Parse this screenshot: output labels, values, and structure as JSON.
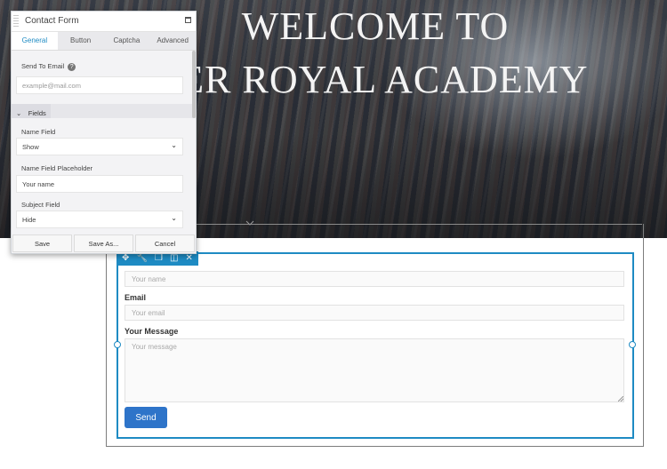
{
  "hero": {
    "line1": "WELCOME TO",
    "line2": "AVER ROYAL ACADEMY"
  },
  "contact_form": {
    "toolbar_icons": [
      "move-icon",
      "wrench-icon",
      "copy-icon",
      "columns-icon",
      "close-icon"
    ],
    "name_placeholder": "Your name",
    "email_label": "Email",
    "email_placeholder": "Your email",
    "message_label": "Your Message",
    "message_placeholder": "Your message",
    "send_label": "Send"
  },
  "panel": {
    "grip_text": "MOVE",
    "title": "Contact Form",
    "tabs": [
      {
        "label": "General",
        "active": true
      },
      {
        "label": "Button",
        "active": false
      },
      {
        "label": "Captcha",
        "active": false
      },
      {
        "label": "Advanced",
        "active": false
      }
    ],
    "send_to_email_label": "Send To Email",
    "help_icon": "?",
    "send_to_email_placeholder": "example@mail.com",
    "section_label": "Fields",
    "name_field_label": "Name Field",
    "name_field_value": "Show",
    "name_placeholder_label": "Name Field Placeholder",
    "name_placeholder_value": "Your name",
    "subject_field_label": "Subject Field",
    "subject_field_value": "Hide",
    "buttons": {
      "save": "Save",
      "save_as": "Save As...",
      "cancel": "Cancel"
    }
  },
  "colors": {
    "accent": "#1e8bc3",
    "send_button": "#2e74c9"
  }
}
